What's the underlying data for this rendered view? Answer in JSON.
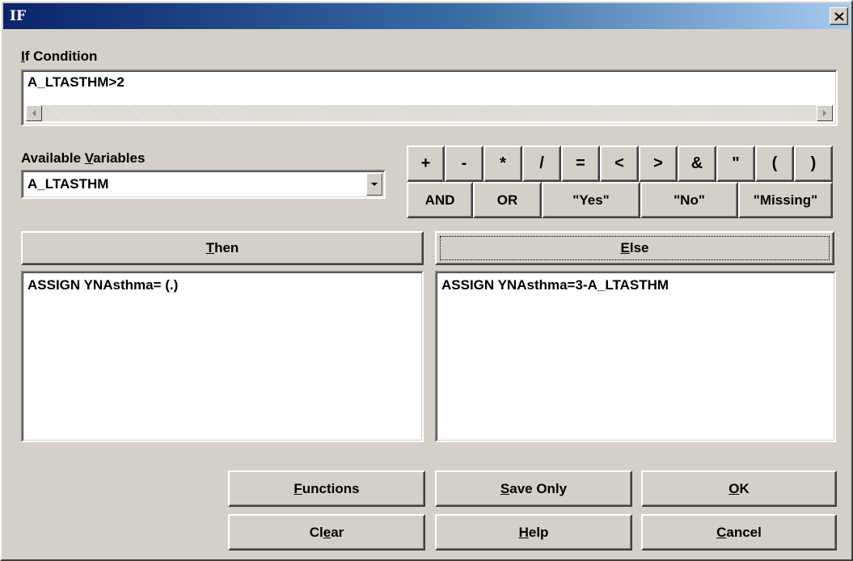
{
  "window": {
    "title": "IF",
    "close_glyph": "✕"
  },
  "condition": {
    "label_accel": "I",
    "label_rest": "f Condition",
    "value": "A_LTASTHM>2"
  },
  "variables": {
    "label_pre": "Available ",
    "label_accel": "V",
    "label_post": "ariables",
    "selected": "A_LTASTHM"
  },
  "operators": {
    "row1": [
      "+",
      "-",
      "*",
      "/",
      "=",
      "<",
      ">",
      "&",
      "\"",
      "(",
      ")"
    ],
    "row2": [
      "AND",
      "OR",
      "\"Yes\"",
      "\"No\"",
      "\"Missing\""
    ]
  },
  "then": {
    "label_accel": "T",
    "label_rest": "hen",
    "text": "ASSIGN YNAsthma= (.)"
  },
  "else": {
    "label_accel": "E",
    "label_rest": "lse",
    "text": "ASSIGN YNAsthma=3-A_LTASTHM"
  },
  "buttons": {
    "functions": {
      "accel": "F",
      "rest": "unctions"
    },
    "save_only": {
      "accel": "S",
      "rest": "ave Only"
    },
    "ok": {
      "accel": "O",
      "rest": "K"
    },
    "clear": {
      "pre": "Cl",
      "accel": "e",
      "rest": "ar"
    },
    "help": {
      "accel": "H",
      "rest": "elp"
    },
    "cancel": {
      "accel": "C",
      "rest": "ancel"
    }
  },
  "icons": {
    "close": "close-icon",
    "scroll_left": "arrow-left-icon",
    "scroll_right": "arrow-right-icon",
    "dropdown": "chevron-down-icon"
  },
  "colors": {
    "face": "#d4d0c8",
    "title_start": "#0a246a",
    "title_end": "#a6caf0"
  }
}
